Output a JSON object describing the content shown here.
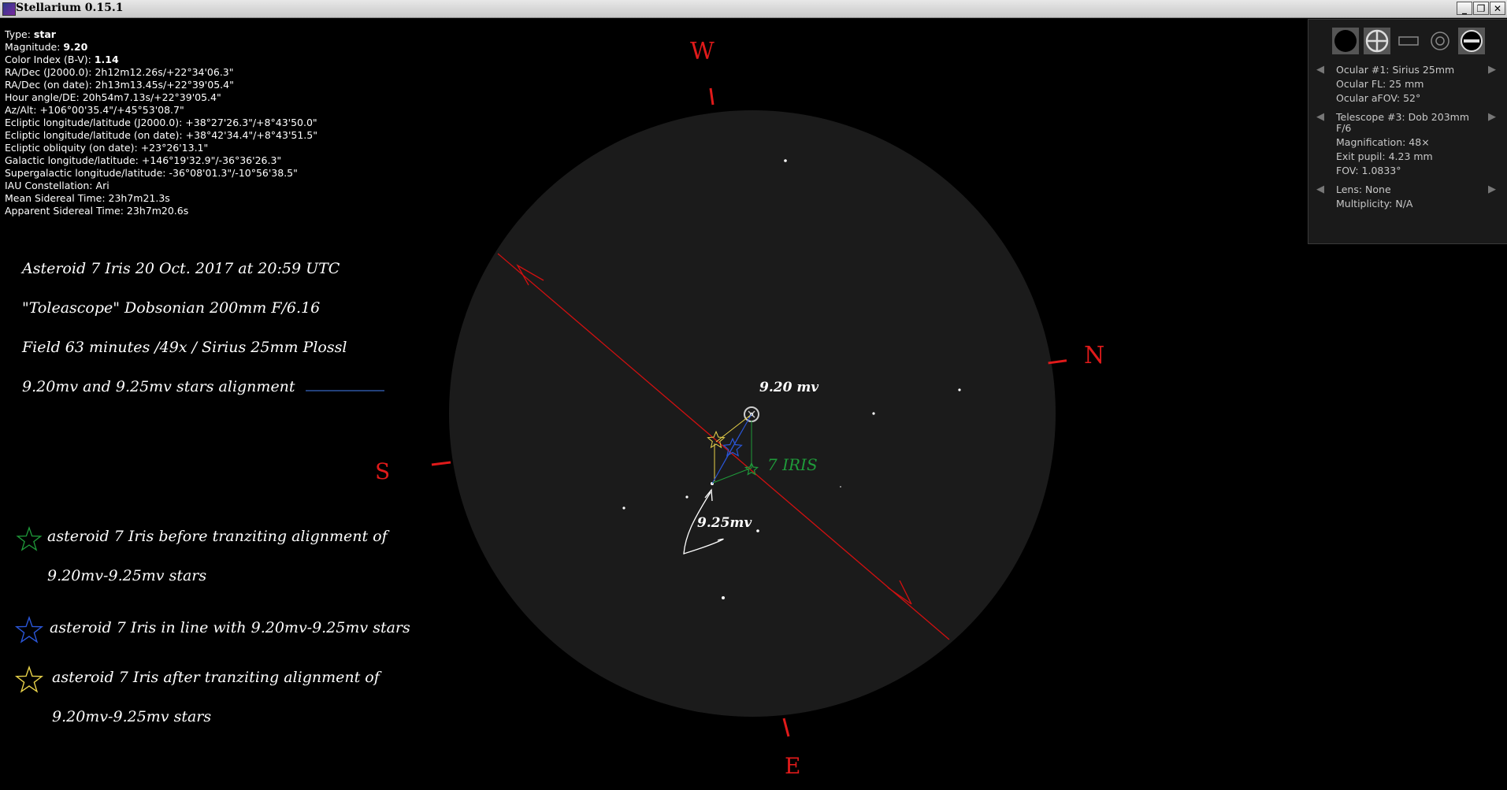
{
  "window": {
    "title": "Stellarium 0.15.1",
    "buttons": [
      "_",
      "❐",
      "✕"
    ]
  },
  "object_info": [
    {
      "label": "Type:",
      "value": "star",
      "bold": true
    },
    {
      "label": "Magnitude:",
      "value": "9.20",
      "bold": true
    },
    {
      "label": "Color Index (B-V):",
      "value": "1.14",
      "bold": true
    },
    {
      "label": "RA/Dec (J2000.0):",
      "value": "2h12m12.26s/+22°34'06.3\""
    },
    {
      "label": "RA/Dec (on date):",
      "value": "2h13m13.45s/+22°39'05.4\""
    },
    {
      "label": "Hour angle/DE:",
      "value": "20h54m7.13s/+22°39'05.4\""
    },
    {
      "label": "Az/Alt:",
      "value": "+106°00'35.4\"/+45°53'08.7\""
    },
    {
      "label": "Ecliptic longitude/latitude (J2000.0):",
      "value": "+38°27'26.3\"/+8°43'50.0\""
    },
    {
      "label": "Ecliptic longitude/latitude (on date):",
      "value": "+38°42'34.4\"/+8°43'51.5\""
    },
    {
      "label": "Ecliptic obliquity (on date):",
      "value": "+23°26'13.1\""
    },
    {
      "label": "Galactic longitude/latitude:",
      "value": "+146°19'32.9\"/-36°36'26.3\""
    },
    {
      "label": "Supergalactic longitude/latitude:",
      "value": "-36°08'01.3\"/-10°56'38.5\""
    },
    {
      "label": "IAU Constellation:",
      "value": "Ari"
    },
    {
      "label": "Mean Sidereal Time:",
      "value": "23h7m21.3s"
    },
    {
      "label": "Apparent Sidereal Time:",
      "value": "23h7m20.6s"
    }
  ],
  "notes": {
    "line1": "Asteroid 7 Iris 20 Oct. 2017  at 20:59 UTC",
    "line2": "\"Toleascope\" Dobsonian 200mm F/6.16",
    "line3": "Field 63 minutes /49x / Sirius 25mm Plossl",
    "line4": "9.20mv and 9.25mv stars alignment",
    "legend_green_1": "asteroid 7 Iris before tranziting  alignment of",
    "legend_green_2": "9.20mv-9.25mv stars",
    "legend_blue": "asteroid 7 Iris  in line with 9.20mv-9.25mv stars",
    "legend_yellow_1": "asteroid 7 Iris after tranziting alignment of",
    "legend_yellow_2": "9.20mv-9.25mv stars"
  },
  "colors": {
    "legend_green": "#1f9a3a",
    "legend_blue": "#2a56d8",
    "legend_yellow": "#e8d24a",
    "cardinal_red": "#e01a1a",
    "line_navy": "#22407a",
    "field_gray": "#1b1b1b",
    "ecliptic_red": "#d01010"
  },
  "cardinals": {
    "west": "W",
    "north": "N",
    "south": "S",
    "east": "E"
  },
  "sky_labels": {
    "mag920": "9.20 mv",
    "mag925": "9.25mv",
    "iris": "7 IRIS"
  },
  "ocular_panel": {
    "icons": [
      "ocular-view-icon",
      "crosshair-icon",
      "ccd-frame-icon",
      "telrad-icon",
      "configure-icon"
    ],
    "ocular": "Ocular #1: Sirius 25mm",
    "ocular_fl": "Ocular FL: 25 mm",
    "ocular_afov": "Ocular aFOV: 52°",
    "telescope_1": "Telescope #3: Dob 203mm",
    "telescope_2": "F/6",
    "magnification": "Magnification: 48×",
    "exit_pupil": "Exit pupil: 4.23 mm",
    "fov": "FOV: 1.0833°",
    "lens": "Lens: None",
    "multiplicity": "Multiplicity: N/A"
  }
}
